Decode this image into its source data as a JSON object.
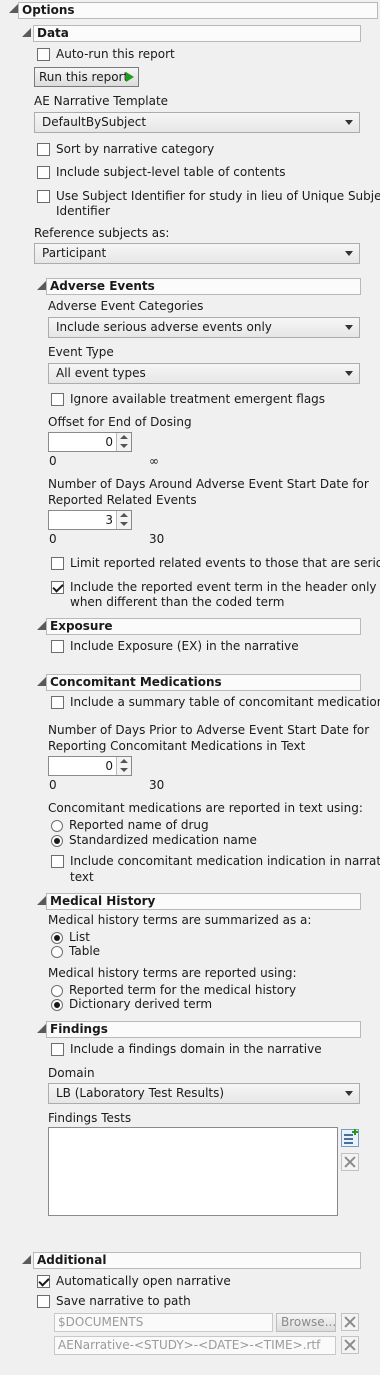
{
  "options": {
    "title": "Options"
  },
  "data": {
    "title": "Data",
    "auto_run_label": "Auto-run this report",
    "auto_run_checked": false,
    "run_button": "Run this report",
    "template_label": "AE Narrative Template",
    "template_value": "DefaultBySubject",
    "sort_label": "Sort by narrative category",
    "toc_label": "Include subject-level table of contents",
    "usubj_line1": "Use Subject Identifier for study in lieu of Unique Subject",
    "usubj_line2": "Identifier",
    "reference_label": "Reference subjects as:",
    "reference_value": "Participant"
  },
  "adverse_events": {
    "title": "Adverse Events",
    "categories_label": "Adverse Event Categories",
    "categories_value": "Include serious adverse events only",
    "event_type_label": "Event Type",
    "event_type_value": "All event types",
    "ignore_label": "Ignore available treatment emergent flags",
    "offset_label": "Offset for End of Dosing",
    "offset_value": "0",
    "offset_min": "0",
    "offset_max": "∞",
    "days_line1": "Number of Days Around Adverse Event Start Date for",
    "days_line2": "Reported Related Events",
    "days_value": "3",
    "days_min": "0",
    "days_max": "30",
    "limit_label": "Limit reported related events to those that are serious",
    "include_term_line1": "Include the reported event term in the header only",
    "include_term_line2": "when different than the coded term",
    "include_term_checked": true
  },
  "exposure": {
    "title": "Exposure",
    "include_label": "Include Exposure (EX) in the narrative"
  },
  "conmeds": {
    "title": "Concomitant Medications",
    "summary_label": "Include a summary table of concomitant medications",
    "days_line1": "Number of Days Prior to Adverse Event Start Date for",
    "days_line2": "Reporting Concomitant Medications in Text",
    "days_value": "0",
    "days_min": "0",
    "days_max": "30",
    "reported_label": "Concomitant medications are reported in text using:",
    "radio_reported": "Reported name of drug",
    "radio_standardized": "Standardized medication name",
    "selected": "standardized",
    "indication_line1": "Include concomitant medication indication in narrative",
    "indication_line2": "text"
  },
  "medical_history": {
    "title": "Medical History",
    "summarized_label": "Medical history terms are summarized as a:",
    "radio_list": "List",
    "radio_table": "Table",
    "summarized_selected": "list",
    "reported_label": "Medical history terms are reported using:",
    "radio_reported_term": "Reported term for the medical history",
    "radio_dictionary": "Dictionary derived term",
    "reported_selected": "dictionary"
  },
  "findings": {
    "title": "Findings",
    "include_label": "Include a findings domain in the narrative",
    "domain_label": "Domain",
    "domain_value": "LB (Laboratory Test Results)",
    "tests_label": "Findings Tests"
  },
  "additional": {
    "title": "Additional",
    "auto_open_label": "Automatically open narrative",
    "auto_open_checked": true,
    "save_label": "Save narrative to path",
    "path_value": "$DOCUMENTS",
    "browse_label": "Browse...",
    "filename_value": "AENarrative-<STUDY>-<DATE>-<TIME>.rtf"
  },
  "icons": {
    "expander": "collapse-triangle-icon",
    "add": "add-list-icon",
    "remove": "remove-x-icon",
    "run": "play-icon"
  },
  "colors": {
    "run_arrow": "#1aa31a",
    "header_bg": "#fbfbfb",
    "panel_bg": "#f0f0f0"
  }
}
